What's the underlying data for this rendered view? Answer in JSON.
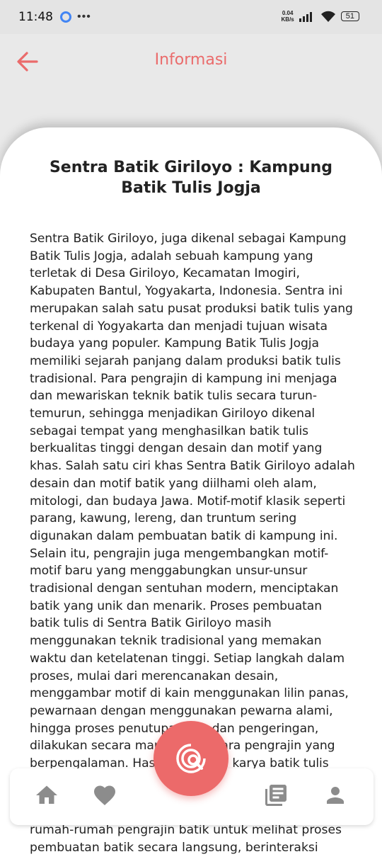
{
  "status": {
    "time": "11:48",
    "speed_value": "0.04",
    "speed_unit": "KB/s",
    "battery": "51"
  },
  "appbar": {
    "title": "Informasi"
  },
  "article": {
    "title": "Sentra Batik Giriloyo : Kampung Batik Tulis Jogja",
    "body": "Sentra Batik Giriloyo, juga dikenal sebagai Kampung Batik Tulis Jogja, adalah sebuah kampung yang terletak di Desa Giriloyo, Kecamatan Imogiri, Kabupaten Bantul, Yogyakarta, Indonesia. Sentra ini merupakan salah satu pusat produksi batik tulis yang terkenal di Yogyakarta dan menjadi tujuan wisata budaya yang populer.  Kampung Batik Tulis Jogja memiliki sejarah panjang dalam produksi batik tulis tradisional. Para pengrajin di kampung ini menjaga dan mewariskan teknik batik tulis secara turun-temurun, sehingga menjadikan Giriloyo dikenal sebagai tempat yang menghasilkan batik tulis berkualitas tinggi dengan desain dan motif yang khas. Salah satu ciri khas Sentra Batik Giriloyo adalah desain dan motif batik yang diilhami oleh alam, mitologi, dan budaya Jawa. Motif-motif klasik seperti parang, kawung, lereng, dan truntum sering digunakan dalam pembuatan batik di kampung ini. Selain itu, pengrajin juga mengembangkan motif-motif baru yang menggabungkan unsur-unsur tradisional dengan sentuhan modern, menciptakan batik yang unik dan menarik.  Proses pembuatan batik tulis di Sentra Batik Giriloyo masih menggunakan teknik tradisional yang memakan waktu dan ketelatenan tinggi. Setiap langkah dalam proses, mulai dari merencanakan desain, menggambar motif di kain menggunakan lilin panas, pewarnaan dengan menggunakan pewarna alami, hingga proses penutupan lilin dan pengeringan, dilakukan secara manual oleh para pengrajin yang berpengalaman. Hasilnya adalah karya batik tulis yang indah",
    "below_nav": "rumah-rumah pengrajin batik untuk melihat proses pembuatan batik secara langsung, berinteraksi"
  },
  "nav": {
    "items": [
      "home-icon",
      "heart-icon",
      "scan-search-icon",
      "article-icon",
      "person-icon"
    ]
  },
  "colors": {
    "accent": "#ec6a6a"
  }
}
